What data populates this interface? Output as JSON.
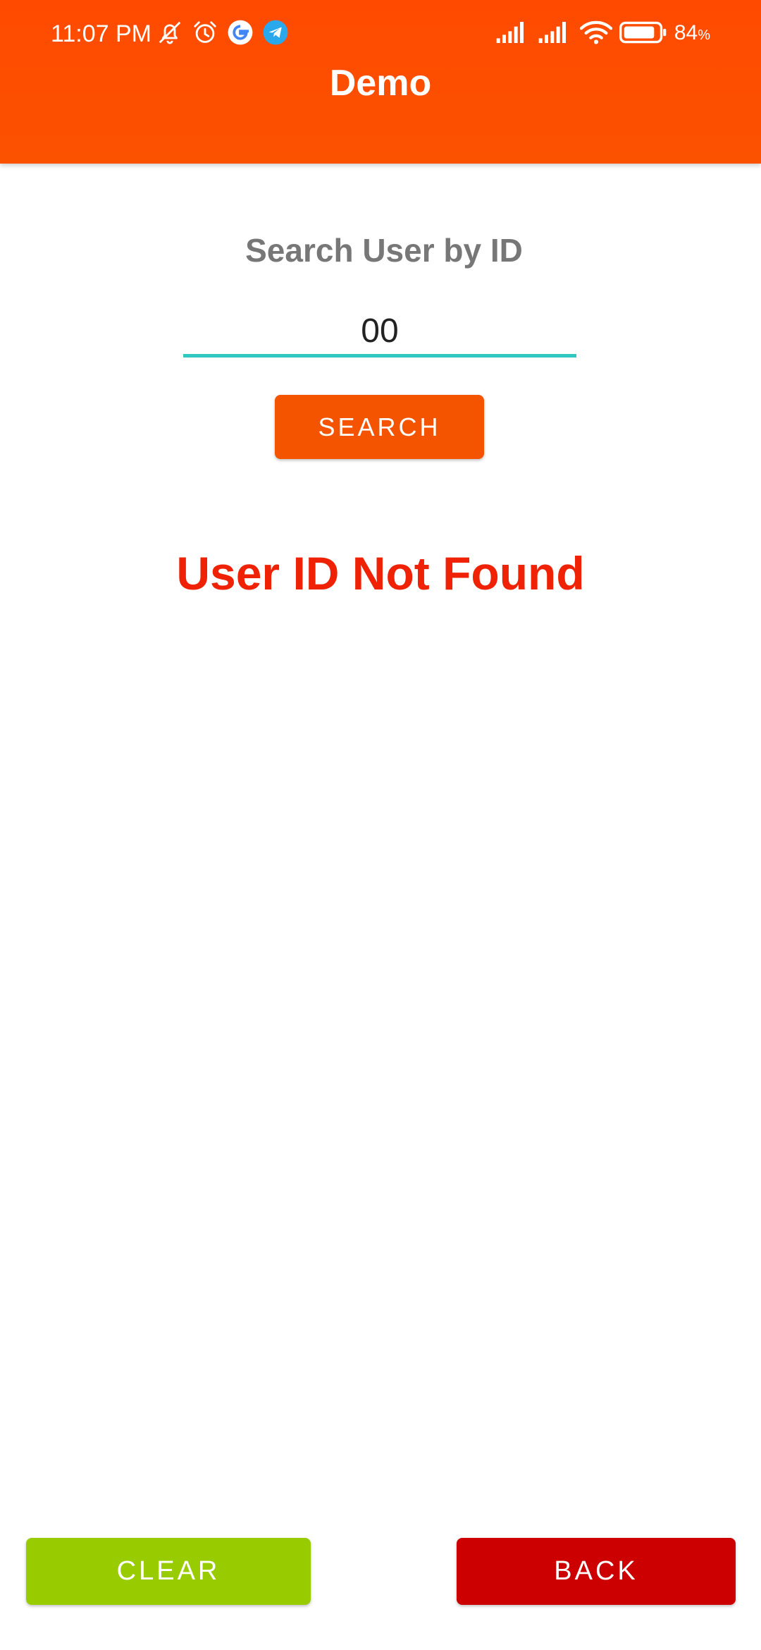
{
  "status_bar": {
    "time": "11:07 PM",
    "battery_percent": "84",
    "battery_unit": "%",
    "left_icons": [
      "bell-off-icon",
      "alarm-clock-icon",
      "google-icon",
      "telegram-icon"
    ],
    "right_icons": [
      "signal-icon",
      "signal-icon",
      "wifi-icon",
      "battery-icon"
    ]
  },
  "app_bar": {
    "title": "Demo",
    "color": "#fb4c00"
  },
  "search": {
    "label": "Search User by ID",
    "input_value": "00",
    "button_label": "SEARCH",
    "button_color": "#f45300",
    "underline_color": "#2ec8c0"
  },
  "result": {
    "message": "User ID Not Found",
    "color": "#ef2206"
  },
  "footer": {
    "clear_label": "CLEAR",
    "clear_color": "#99cc00",
    "back_label": "BACK",
    "back_color": "#cc0000"
  }
}
